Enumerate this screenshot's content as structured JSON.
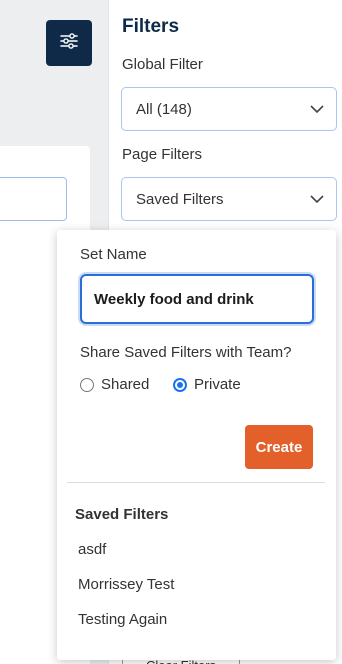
{
  "sidebar": {
    "title": "Filters",
    "global_filter": {
      "label": "Global Filter",
      "value": "All (148)"
    },
    "page_filters": {
      "label": "Page Filters",
      "value": "Saved Filters"
    },
    "clear_button": "Clear Filters"
  },
  "popover": {
    "set_name_label": "Set Name",
    "set_name_value": "Weekly food and drink",
    "share_label": "Share Saved Filters with Team?",
    "share_options": [
      {
        "label": "Shared",
        "checked": false
      },
      {
        "label": "Private",
        "checked": true
      }
    ],
    "create_label": "Create",
    "saved_heading": "Saved Filters",
    "saved_items": [
      "asdf",
      "Morrissey Test",
      "Testing Again"
    ]
  },
  "colors": {
    "navy": "#0f2a48",
    "accent_orange": "#e4602a",
    "focus_blue": "#2b6fd6"
  },
  "icons": {
    "filter_toggle": "sliders-icon",
    "dropdown": "chevron-down-icon"
  }
}
